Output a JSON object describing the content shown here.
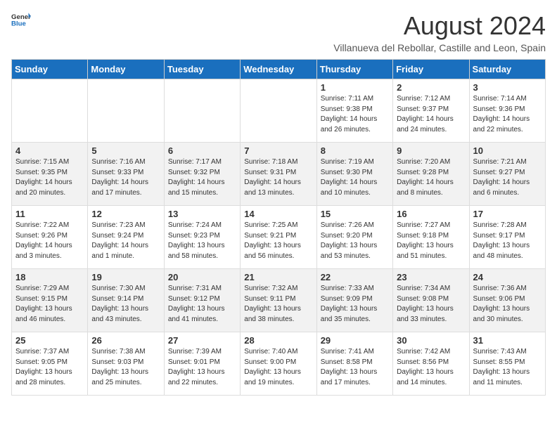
{
  "header": {
    "logo_general": "General",
    "logo_blue": "Blue",
    "title": "August 2024",
    "subtitle": "Villanueva del Rebollar, Castille and Leon, Spain"
  },
  "calendar": {
    "weekdays": [
      "Sunday",
      "Monday",
      "Tuesday",
      "Wednesday",
      "Thursday",
      "Friday",
      "Saturday"
    ],
    "weeks": [
      [
        {
          "day": "",
          "sunrise": "",
          "sunset": "",
          "daylight": ""
        },
        {
          "day": "",
          "sunrise": "",
          "sunset": "",
          "daylight": ""
        },
        {
          "day": "",
          "sunrise": "",
          "sunset": "",
          "daylight": ""
        },
        {
          "day": "",
          "sunrise": "",
          "sunset": "",
          "daylight": ""
        },
        {
          "day": "1",
          "sunrise": "Sunrise: 7:11 AM",
          "sunset": "Sunset: 9:38 PM",
          "daylight": "Daylight: 14 hours and 26 minutes."
        },
        {
          "day": "2",
          "sunrise": "Sunrise: 7:12 AM",
          "sunset": "Sunset: 9:37 PM",
          "daylight": "Daylight: 14 hours and 24 minutes."
        },
        {
          "day": "3",
          "sunrise": "Sunrise: 7:14 AM",
          "sunset": "Sunset: 9:36 PM",
          "daylight": "Daylight: 14 hours and 22 minutes."
        }
      ],
      [
        {
          "day": "4",
          "sunrise": "Sunrise: 7:15 AM",
          "sunset": "Sunset: 9:35 PM",
          "daylight": "Daylight: 14 hours and 20 minutes."
        },
        {
          "day": "5",
          "sunrise": "Sunrise: 7:16 AM",
          "sunset": "Sunset: 9:33 PM",
          "daylight": "Daylight: 14 hours and 17 minutes."
        },
        {
          "day": "6",
          "sunrise": "Sunrise: 7:17 AM",
          "sunset": "Sunset: 9:32 PM",
          "daylight": "Daylight: 14 hours and 15 minutes."
        },
        {
          "day": "7",
          "sunrise": "Sunrise: 7:18 AM",
          "sunset": "Sunset: 9:31 PM",
          "daylight": "Daylight: 14 hours and 13 minutes."
        },
        {
          "day": "8",
          "sunrise": "Sunrise: 7:19 AM",
          "sunset": "Sunset: 9:30 PM",
          "daylight": "Daylight: 14 hours and 10 minutes."
        },
        {
          "day": "9",
          "sunrise": "Sunrise: 7:20 AM",
          "sunset": "Sunset: 9:28 PM",
          "daylight": "Daylight: 14 hours and 8 minutes."
        },
        {
          "day": "10",
          "sunrise": "Sunrise: 7:21 AM",
          "sunset": "Sunset: 9:27 PM",
          "daylight": "Daylight: 14 hours and 6 minutes."
        }
      ],
      [
        {
          "day": "11",
          "sunrise": "Sunrise: 7:22 AM",
          "sunset": "Sunset: 9:26 PM",
          "daylight": "Daylight: 14 hours and 3 minutes."
        },
        {
          "day": "12",
          "sunrise": "Sunrise: 7:23 AM",
          "sunset": "Sunset: 9:24 PM",
          "daylight": "Daylight: 14 hours and 1 minute."
        },
        {
          "day": "13",
          "sunrise": "Sunrise: 7:24 AM",
          "sunset": "Sunset: 9:23 PM",
          "daylight": "Daylight: 13 hours and 58 minutes."
        },
        {
          "day": "14",
          "sunrise": "Sunrise: 7:25 AM",
          "sunset": "Sunset: 9:21 PM",
          "daylight": "Daylight: 13 hours and 56 minutes."
        },
        {
          "day": "15",
          "sunrise": "Sunrise: 7:26 AM",
          "sunset": "Sunset: 9:20 PM",
          "daylight": "Daylight: 13 hours and 53 minutes."
        },
        {
          "day": "16",
          "sunrise": "Sunrise: 7:27 AM",
          "sunset": "Sunset: 9:18 PM",
          "daylight": "Daylight: 13 hours and 51 minutes."
        },
        {
          "day": "17",
          "sunrise": "Sunrise: 7:28 AM",
          "sunset": "Sunset: 9:17 PM",
          "daylight": "Daylight: 13 hours and 48 minutes."
        }
      ],
      [
        {
          "day": "18",
          "sunrise": "Sunrise: 7:29 AM",
          "sunset": "Sunset: 9:15 PM",
          "daylight": "Daylight: 13 hours and 46 minutes."
        },
        {
          "day": "19",
          "sunrise": "Sunrise: 7:30 AM",
          "sunset": "Sunset: 9:14 PM",
          "daylight": "Daylight: 13 hours and 43 minutes."
        },
        {
          "day": "20",
          "sunrise": "Sunrise: 7:31 AM",
          "sunset": "Sunset: 9:12 PM",
          "daylight": "Daylight: 13 hours and 41 minutes."
        },
        {
          "day": "21",
          "sunrise": "Sunrise: 7:32 AM",
          "sunset": "Sunset: 9:11 PM",
          "daylight": "Daylight: 13 hours and 38 minutes."
        },
        {
          "day": "22",
          "sunrise": "Sunrise: 7:33 AM",
          "sunset": "Sunset: 9:09 PM",
          "daylight": "Daylight: 13 hours and 35 minutes."
        },
        {
          "day": "23",
          "sunrise": "Sunrise: 7:34 AM",
          "sunset": "Sunset: 9:08 PM",
          "daylight": "Daylight: 13 hours and 33 minutes."
        },
        {
          "day": "24",
          "sunrise": "Sunrise: 7:36 AM",
          "sunset": "Sunset: 9:06 PM",
          "daylight": "Daylight: 13 hours and 30 minutes."
        }
      ],
      [
        {
          "day": "25",
          "sunrise": "Sunrise: 7:37 AM",
          "sunset": "Sunset: 9:05 PM",
          "daylight": "Daylight: 13 hours and 28 minutes."
        },
        {
          "day": "26",
          "sunrise": "Sunrise: 7:38 AM",
          "sunset": "Sunset: 9:03 PM",
          "daylight": "Daylight: 13 hours and 25 minutes."
        },
        {
          "day": "27",
          "sunrise": "Sunrise: 7:39 AM",
          "sunset": "Sunset: 9:01 PM",
          "daylight": "Daylight: 13 hours and 22 minutes."
        },
        {
          "day": "28",
          "sunrise": "Sunrise: 7:40 AM",
          "sunset": "Sunset: 9:00 PM",
          "daylight": "Daylight: 13 hours and 19 minutes."
        },
        {
          "day": "29",
          "sunrise": "Sunrise: 7:41 AM",
          "sunset": "Sunset: 8:58 PM",
          "daylight": "Daylight: 13 hours and 17 minutes."
        },
        {
          "day": "30",
          "sunrise": "Sunrise: 7:42 AM",
          "sunset": "Sunset: 8:56 PM",
          "daylight": "Daylight: 13 hours and 14 minutes."
        },
        {
          "day": "31",
          "sunrise": "Sunrise: 7:43 AM",
          "sunset": "Sunset: 8:55 PM",
          "daylight": "Daylight: 13 hours and 11 minutes."
        }
      ]
    ]
  }
}
